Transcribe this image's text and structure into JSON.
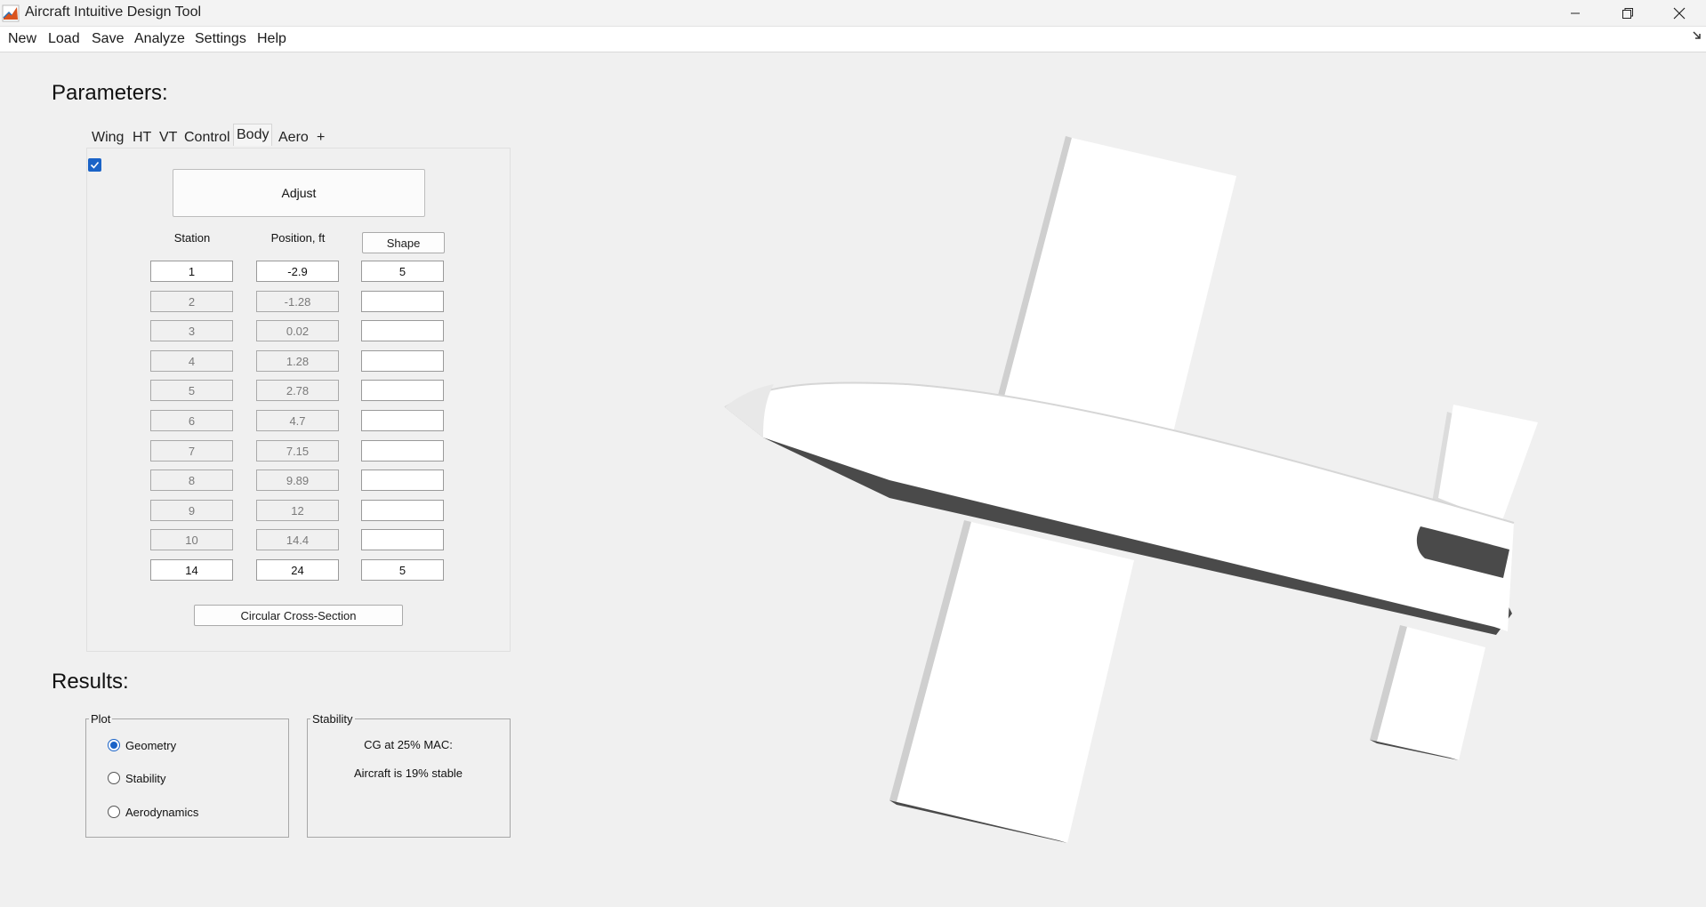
{
  "window": {
    "title": "Aircraft Intuitive Design Tool"
  },
  "menu": [
    "New",
    "Load",
    "Save",
    "Analyze",
    "Settings",
    "Help"
  ],
  "parameters": {
    "heading": "Parameters:",
    "tabs": [
      "Wing",
      "HT",
      "VT",
      "Control",
      "Body",
      "Aero",
      "+"
    ],
    "active_tab": "Body",
    "checkbox_checked": true,
    "adjust_label": "Adjust",
    "columns": {
      "station": "Station",
      "position": "Position, ft",
      "shape": "Shape"
    },
    "rows": [
      {
        "station": "1",
        "position": "-2.9",
        "shape": "5",
        "editable": true
      },
      {
        "station": "2",
        "position": "-1.28",
        "shape": "",
        "editable": false
      },
      {
        "station": "3",
        "position": "0.02",
        "shape": "",
        "editable": false
      },
      {
        "station": "4",
        "position": "1.28",
        "shape": "",
        "editable": false
      },
      {
        "station": "5",
        "position": "2.78",
        "shape": "",
        "editable": false
      },
      {
        "station": "6",
        "position": "4.7",
        "shape": "",
        "editable": false
      },
      {
        "station": "7",
        "position": "7.15",
        "shape": "",
        "editable": false
      },
      {
        "station": "8",
        "position": "9.89",
        "shape": "",
        "editable": false
      },
      {
        "station": "9",
        "position": "12",
        "shape": "",
        "editable": false
      },
      {
        "station": "10",
        "position": "14.4",
        "shape": "",
        "editable": false
      },
      {
        "station": "14",
        "position": "24",
        "shape": "5",
        "editable": true
      }
    ],
    "cross_section_label": "Circular Cross-Section"
  },
  "results": {
    "heading": "Results:",
    "plot_group": "Plot",
    "plot_options": [
      "Geometry",
      "Stability",
      "Aerodynamics"
    ],
    "plot_selected": "Geometry",
    "stability_group": "Stability",
    "cg_text": "CG at 25% MAC:",
    "stable_text": "Aircraft is 19% stable"
  },
  "colors": {
    "accent": "#1a63c7",
    "background": "#f0f0f0",
    "model_dark": "#4a4a4a"
  }
}
